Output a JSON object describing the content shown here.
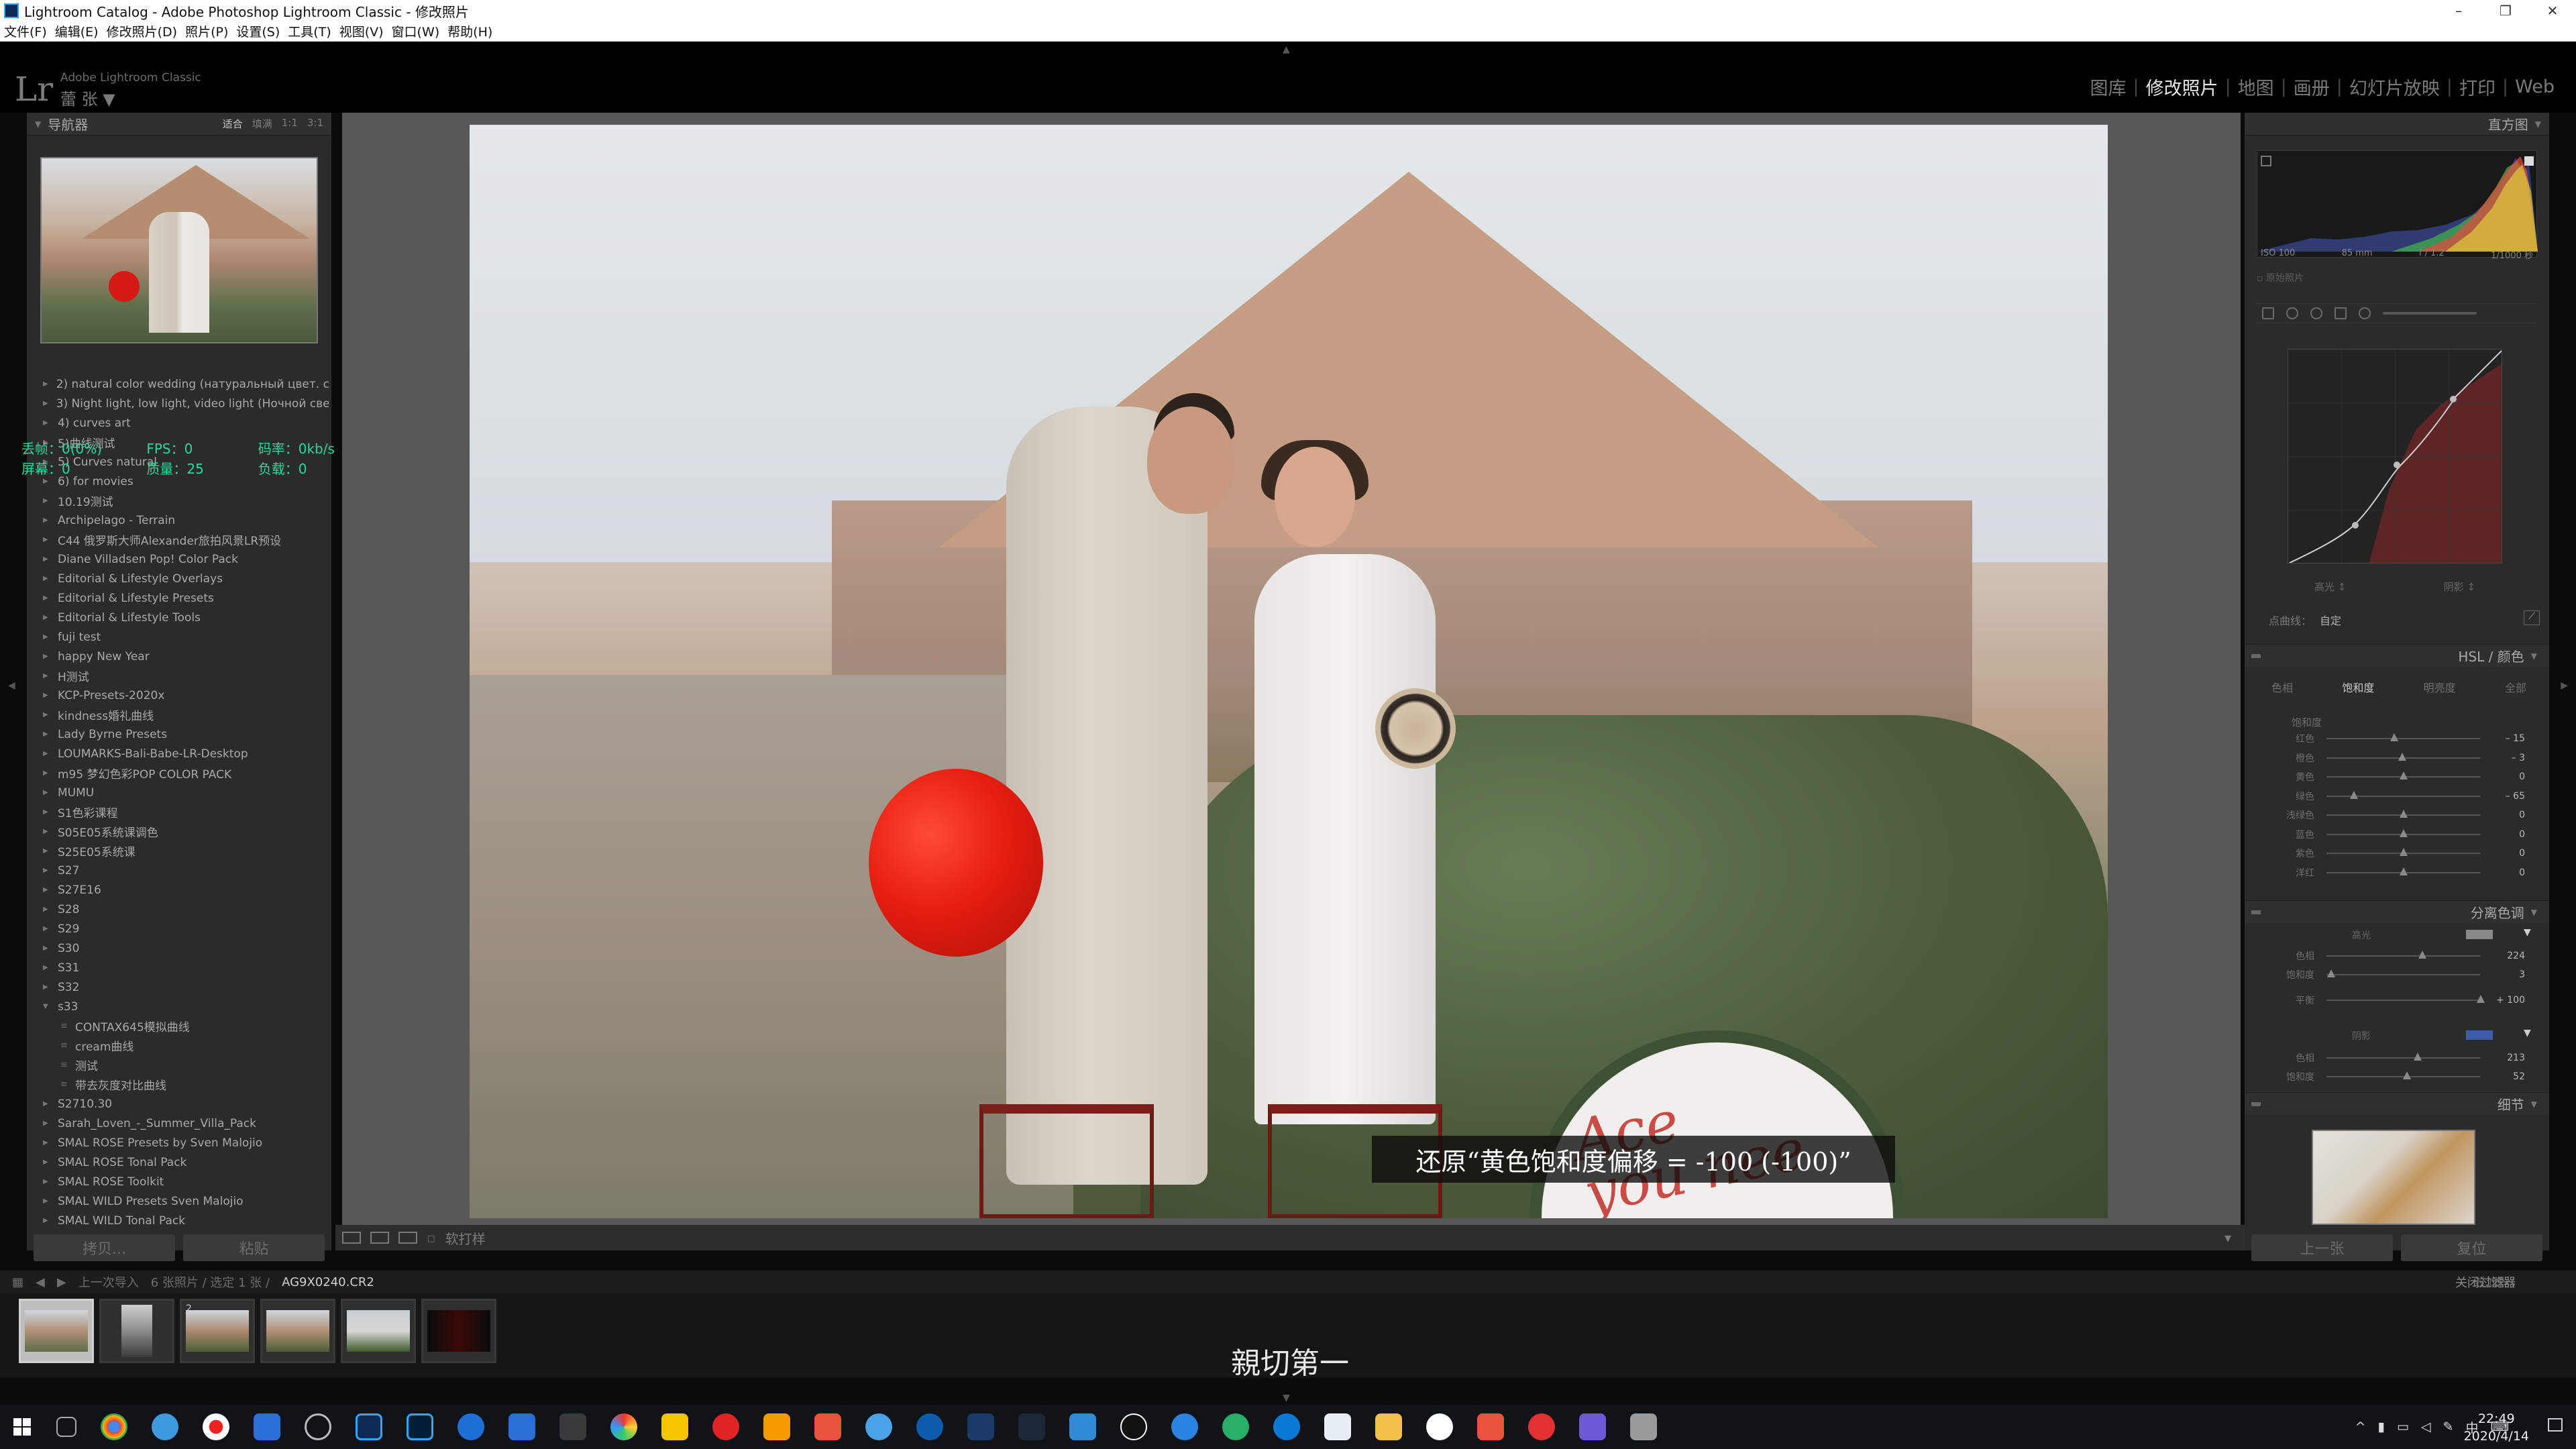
{
  "window": {
    "title": "Lightroom Catalog - Adobe Photoshop Lightroom Classic - 修改照片",
    "minimize": "–",
    "maximize": "❐",
    "close": "✕"
  },
  "menu": [
    "文件(F)",
    "编辑(E)",
    "修改照片(D)",
    "照片(P)",
    "设置(S)",
    "工具(T)",
    "视图(V)",
    "窗口(W)",
    "帮助(H)"
  ],
  "identity": {
    "logo": "Lr",
    "brand": "Adobe Lightroom Classic",
    "user": "蕾 张  ▼"
  },
  "modules": [
    "图库",
    "修改照片",
    "地图",
    "画册",
    "幻灯片放映",
    "打印",
    "Web"
  ],
  "active_module": "修改照片",
  "navigator": {
    "title": "导航器",
    "options": [
      "适合",
      "填满",
      "1:1",
      "3:1"
    ],
    "selected_option": "适合"
  },
  "presets": [
    {
      "label": "2) natural color wedding (натуральный цвет. св...",
      "type": "folder"
    },
    {
      "label": "3) Night light, low light, video light (Ночной све...",
      "type": "folder"
    },
    {
      "label": "4) curves art",
      "type": "folder"
    },
    {
      "label": "5)曲线测试",
      "type": "folder"
    },
    {
      "label": "5) Curves natural",
      "type": "folder"
    },
    {
      "label": "6) for movies",
      "type": "folder"
    },
    {
      "label": "10.19测试",
      "type": "folder"
    },
    {
      "label": "Archipelago - Terrain",
      "type": "folder"
    },
    {
      "label": "C44 俄罗斯大师Alexander旅拍风景LR预设",
      "type": "folder"
    },
    {
      "label": "Diane Villadsen Pop! Color Pack",
      "type": "folder"
    },
    {
      "label": "Editorial & Lifestyle Overlays",
      "type": "folder"
    },
    {
      "label": "Editorial & Lifestyle Presets",
      "type": "folder"
    },
    {
      "label": "Editorial & Lifestyle Tools",
      "type": "folder"
    },
    {
      "label": "fuji test",
      "type": "folder"
    },
    {
      "label": "happy New Year",
      "type": "folder"
    },
    {
      "label": "H测试",
      "type": "folder"
    },
    {
      "label": "KCP-Presets-2020x",
      "type": "folder"
    },
    {
      "label": "kindness婚礼曲线",
      "type": "folder"
    },
    {
      "label": "Lady Byrne Presets",
      "type": "folder"
    },
    {
      "label": "LOUMARKS-Bali-Babe-LR-Desktop",
      "type": "folder"
    },
    {
      "label": "m95 梦幻色彩POP COLOR PACK",
      "type": "folder"
    },
    {
      "label": "MUMU",
      "type": "folder"
    },
    {
      "label": "S1色彩课程",
      "type": "folder"
    },
    {
      "label": "S05E05系统课调色",
      "type": "folder"
    },
    {
      "label": "S25E05系统课",
      "type": "folder"
    },
    {
      "label": "S27",
      "type": "folder"
    },
    {
      "label": "S27E16",
      "type": "folder"
    },
    {
      "label": "S28",
      "type": "folder"
    },
    {
      "label": "S29",
      "type": "folder"
    },
    {
      "label": "S30",
      "type": "folder"
    },
    {
      "label": "S31",
      "type": "folder"
    },
    {
      "label": "S32",
      "type": "folder"
    },
    {
      "label": "s33",
      "type": "open"
    },
    {
      "label": "CONTAX645模拟曲线",
      "type": "child"
    },
    {
      "label": "cream曲线",
      "type": "child"
    },
    {
      "label": "测试",
      "type": "child"
    },
    {
      "label": "带去灰度对比曲线",
      "type": "child"
    },
    {
      "label": "S2710.30",
      "type": "folder"
    },
    {
      "label": "Sarah_Loven_-_Summer_Villa_Pack",
      "type": "folder"
    },
    {
      "label": "SMAL ROSE Presets by Sven Malojio",
      "type": "folder"
    },
    {
      "label": "SMAL ROSE Tonal Pack",
      "type": "folder"
    },
    {
      "label": "SMAL ROSE Toolkit",
      "type": "folder"
    },
    {
      "label": "SMAL WILD Presets Sven Malojio",
      "type": "folder"
    },
    {
      "label": "SMAL WILD Tonal Pack",
      "type": "folder"
    }
  ],
  "stats": {
    "line1": [
      "丢帧：0(0%)",
      "FPS：0",
      "码率：0kb/s"
    ],
    "line2": [
      "屏幕：0",
      "质量：25",
      "负载：0"
    ]
  },
  "left_buttons": {
    "copy": "拷贝...",
    "paste": "粘贴"
  },
  "subtitle": "还原“黄色饱和度偏移 = -100 (-100)”",
  "toolbar": {
    "soft_proof": "软打样"
  },
  "filmbar": {
    "prefix": "上一次导入",
    "count": "6 张照片 / 选定 1 张 /",
    "filename": "AG9X0240.CR2",
    "filter_label": "过滤器：",
    "filter_value": "关闭过滤器"
  },
  "film_caption": "親切第一",
  "right_panel": {
    "histogram_title": "直方图",
    "exif": [
      "ISO 100",
      "85 mm",
      "f / 1.2",
      "1/1000 秒"
    ],
    "original_photo": "原始照片",
    "curve_channels": [
      "高光 ↕",
      "阴影 ↕"
    ],
    "point_curve_label": "点曲线：",
    "point_curve_value": "自定",
    "hsl_title": "HSL / 颜色",
    "hsl_tabs": [
      "色相",
      "饱和度",
      "明亮度",
      "全部"
    ],
    "hsl_active_tab": "饱和度",
    "hsl_group": "饱和度",
    "hsl_sliders": [
      {
        "label": "红色",
        "value": "– 15",
        "pos": 0.44
      },
      {
        "label": "橙色",
        "value": "– 3",
        "pos": 0.49
      },
      {
        "label": "黄色",
        "value": "0",
        "pos": 0.5
      },
      {
        "label": "绿色",
        "value": "– 65",
        "pos": 0.18
      },
      {
        "label": "浅绿色",
        "value": "0",
        "pos": 0.5
      },
      {
        "label": "蓝色",
        "value": "0",
        "pos": 0.5
      },
      {
        "label": "紫色",
        "value": "0",
        "pos": 0.5
      },
      {
        "label": "洋红",
        "value": "0",
        "pos": 0.5
      }
    ],
    "split_title": "分离色调",
    "split_highlights": "高光",
    "split_shadows": "阴影",
    "split_sliders": [
      {
        "label": "色相",
        "value": "224",
        "pos": 0.62
      },
      {
        "label": "饱和度",
        "value": "3",
        "pos": 0.03
      },
      {
        "label": "平衡",
        "value": "+ 100",
        "pos": 1.0
      },
      {
        "label": "色相",
        "value": "213",
        "pos": 0.59
      },
      {
        "label": "饱和度",
        "value": "52",
        "pos": 0.52
      }
    ],
    "detail_title": "细节",
    "prev_button": "上一张",
    "reset_button": "复位"
  },
  "taskbar": {
    "time": "22:49",
    "date": "2020/4/14",
    "ime": "中"
  },
  "colors": {
    "lr_blue": "#31a8ff",
    "accent_text": "#e6e6e6",
    "stats_green": "#2bd99a",
    "balloon_red": "#e61e10"
  }
}
